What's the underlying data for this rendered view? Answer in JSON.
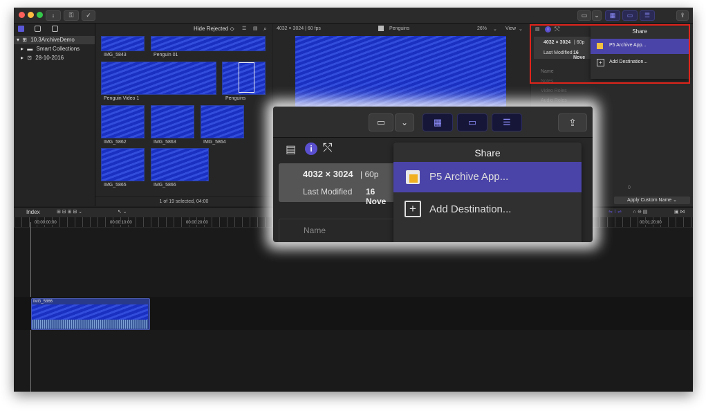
{
  "toolbar": {
    "buttons": [
      "↓",
      "⚿",
      "✓"
    ]
  },
  "libraries": {
    "items": [
      {
        "label": "10.3ArchiveDemo",
        "icon": "library-icon"
      },
      {
        "label": "Smart Collections",
        "icon": "folder-icon"
      },
      {
        "label": "28-10-2016",
        "icon": "event-icon"
      }
    ]
  },
  "browser": {
    "filter": "Hide Rejected ◇",
    "clips": [
      {
        "label": "IMG_5843"
      },
      {
        "label": "Penguin 01"
      },
      {
        "label": "Penguin Video 1"
      },
      {
        "label": "Penguins"
      },
      {
        "label": "IMG_5862"
      },
      {
        "label": "IMG_5863"
      },
      {
        "label": "IMG_5864"
      },
      {
        "label": "IMG_5865"
      },
      {
        "label": "IMG_5866"
      }
    ],
    "status": "1 of 19 selected, 04:00"
  },
  "viewer": {
    "format": "4032 × 3024 | 60 fps",
    "title": "Penguins",
    "zoom": "26%",
    "view": "View"
  },
  "inspector": {
    "dims": "4032 × 3024",
    "fps": "| 60p",
    "modified_label": "Last Modified",
    "modified_value": "16 Nove",
    "name_label": "Name",
    "notes_label": "Notes",
    "video_roles": "Video Roles",
    "audio_roles": "Audio Roles",
    "zero": "0",
    "apply_button": "Apply Custom Name ⌄"
  },
  "share_menu": {
    "title": "Share",
    "items": [
      "P5 Archive App...",
      "Add Destination..."
    ]
  },
  "timeline": {
    "index_label": "Index",
    "timecodes": [
      "00:00:00:00",
      "00:00:10:00",
      "00:00:20:00",
      "00:01:20:00"
    ],
    "clip_label": "IMG_5866"
  },
  "zoom": {
    "dims": "4032 × 3024",
    "fps": "| 60p",
    "modified_label": "Last Modified",
    "modified_value": "16 Nove",
    "name_label": "Name",
    "share_title": "Share",
    "item1": "P5 Archive App...",
    "item2": "Add Destination..."
  },
  "colors": {
    "accent": "#5a4fcf",
    "highlight_box": "#e0241b",
    "clip_blue": "#1c35c8"
  }
}
